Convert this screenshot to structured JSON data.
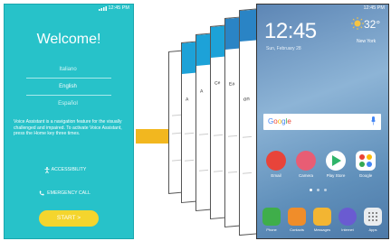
{
  "welcome": {
    "status_time": "12:45 PM",
    "title": "Welcome!",
    "languages": [
      "Italiano",
      "English",
      "Español"
    ],
    "description": "Voice Assistant is a navigation feature for the visually challenged and impaired. To activate Voice Assistant, press the Home key three times.",
    "accessibility_label": "ACCESSIBILITY",
    "emergency_label": "EMERGENCY CALL",
    "start_label": "START  >",
    "bg_color": "#27c2c9",
    "start_color": "#f4d52d"
  },
  "cards": {
    "letters": [
      "A",
      "A",
      "Ce",
      "Ea",
      "on"
    ]
  },
  "home": {
    "status_time": "12:45 PM",
    "clock": "12:45",
    "date": "Sun, February 28",
    "temperature": "32°",
    "city": "New York",
    "search_brand": "Google",
    "apps": [
      "Email",
      "Camera",
      "Play Store",
      "Google"
    ],
    "dock": [
      "Phone",
      "Contacts",
      "Messages",
      "Internet",
      "Apps"
    ]
  }
}
